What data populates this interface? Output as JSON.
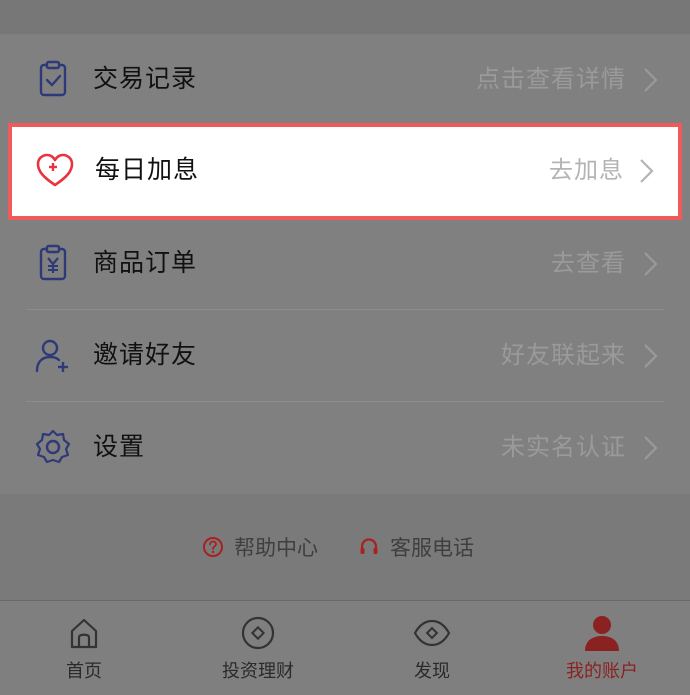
{
  "menu": {
    "items": [
      {
        "label": "交易记录",
        "hint": "点击查看详情",
        "icon": "clipboard-check-icon"
      },
      {
        "label": "每日加息",
        "hint": "去加息",
        "icon": "heart-plus-icon"
      },
      {
        "label": "商品订单",
        "hint": "去查看",
        "icon": "clipboard-yuan-icon"
      },
      {
        "label": "邀请好友",
        "hint": "好友联起来",
        "icon": "user-plus-icon"
      },
      {
        "label": "设置",
        "hint": "未实名认证",
        "icon": "gear-icon"
      }
    ]
  },
  "help": {
    "help_center": "帮助中心",
    "customer_service": "客服电话"
  },
  "tabs": [
    {
      "label": "首页",
      "icon": "home-icon"
    },
    {
      "label": "投资理财",
      "icon": "invest-coin-icon"
    },
    {
      "label": "发现",
      "icon": "eye-icon"
    },
    {
      "label": "我的账户",
      "icon": "person-icon",
      "active": true
    }
  ],
  "colors": {
    "accent_blue": "#2e3a78",
    "highlight_border": "#f05a5a",
    "heart_red": "#e8343f",
    "active_tab": "#8b2222",
    "help_icon_red": "#a82020"
  }
}
